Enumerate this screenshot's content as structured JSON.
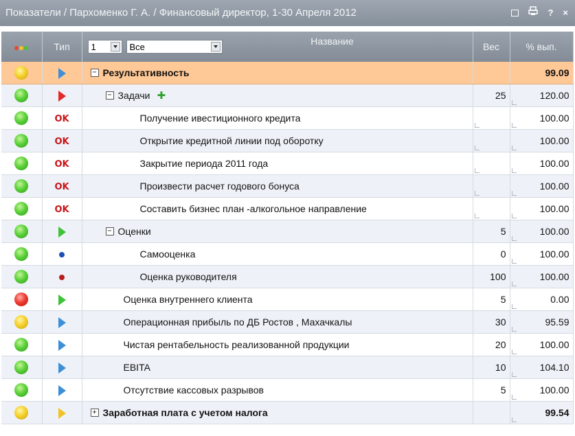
{
  "window": {
    "title": "Показатели / Пархоменко Г. А. / Финансовый директор, 1-30 Апреля 2012",
    "tools": {
      "restore_icon": "window-restore-icon",
      "print_icon": "print-icon",
      "help": "?",
      "close": "×"
    }
  },
  "header": {
    "type": "Тип",
    "name": "Название",
    "weight": "Вес",
    "percent": "% вып.",
    "level_select": "1",
    "filter_select": "Все",
    "status_colors": [
      "#e8463a",
      "#f2c22a",
      "#4cc23a"
    ]
  },
  "rows": [
    {
      "status": "yellow",
      "type": "tri-blue",
      "name": "Результативность",
      "level": 0,
      "expander": "−",
      "bold": true,
      "weight": "",
      "percent": "99.09",
      "selected": true
    },
    {
      "status": "green",
      "type": "tri-red",
      "name": "Задачи",
      "level": 1,
      "expander": "−",
      "plus": "✚",
      "weight": "25",
      "percent": "120.00"
    },
    {
      "status": "green",
      "type": "ok",
      "type_label": "OK",
      "name": "Получение ивестиционного кредита",
      "level": 2,
      "weight": "",
      "percent": "100.00"
    },
    {
      "status": "green",
      "type": "ok",
      "type_label": "OK",
      "name": "Открытие кредитной линии под оборотку",
      "level": 2,
      "weight": "",
      "percent": "100.00"
    },
    {
      "status": "green",
      "type": "ok",
      "type_label": "OK",
      "name": "Закрытие периода 2011 года",
      "level": 2,
      "weight": "",
      "percent": "100.00"
    },
    {
      "status": "green",
      "type": "ok",
      "type_label": "OK",
      "name": "Произвести расчет годового бонуса",
      "level": 2,
      "weight": "",
      "percent": "100.00"
    },
    {
      "status": "green",
      "type": "ok",
      "type_label": "OK",
      "name": "Составить бизнес план -алкогольное направление",
      "level": 2,
      "weight": "",
      "percent": "100.00"
    },
    {
      "status": "green",
      "type": "tri-green",
      "name": "Оценки",
      "level": 1,
      "expander": "−",
      "weight": "5",
      "percent": "100.00"
    },
    {
      "status": "green",
      "type": "dot-blue",
      "name": "Самооценка",
      "level": 2,
      "weight": "0",
      "percent": "100.00"
    },
    {
      "status": "green",
      "type": "dot-red",
      "name": "Оценка руководителя",
      "level": 2,
      "weight": "100",
      "percent": "100.00"
    },
    {
      "status": "red",
      "type": "tri-green",
      "name": "Оценка внутреннего клиента",
      "level": 1,
      "weight": "5",
      "percent": "0.00"
    },
    {
      "status": "yellow",
      "type": "tri-blue",
      "name": "Операционная прибыль по ДБ Ростов , Махачкалы",
      "level": 1,
      "weight": "30",
      "percent": "95.59"
    },
    {
      "status": "green",
      "type": "tri-blue",
      "name": "Чистая рентабельность реализованной продукции",
      "level": 1,
      "weight": "20",
      "percent": "100.00"
    },
    {
      "status": "green",
      "type": "tri-blue",
      "name": "EBITA",
      "level": 1,
      "weight": "10",
      "percent": "104.10"
    },
    {
      "status": "green",
      "type": "tri-blue",
      "name": "Отсутствие кассовых разрывов",
      "level": 1,
      "weight": "5",
      "percent": "100.00"
    },
    {
      "status": "yellow",
      "type": "tri-yellow",
      "name": "Заработная плата с учетом налога",
      "level": 0,
      "expander": "+",
      "bold": true,
      "weight": "",
      "percent": "99.54"
    }
  ]
}
